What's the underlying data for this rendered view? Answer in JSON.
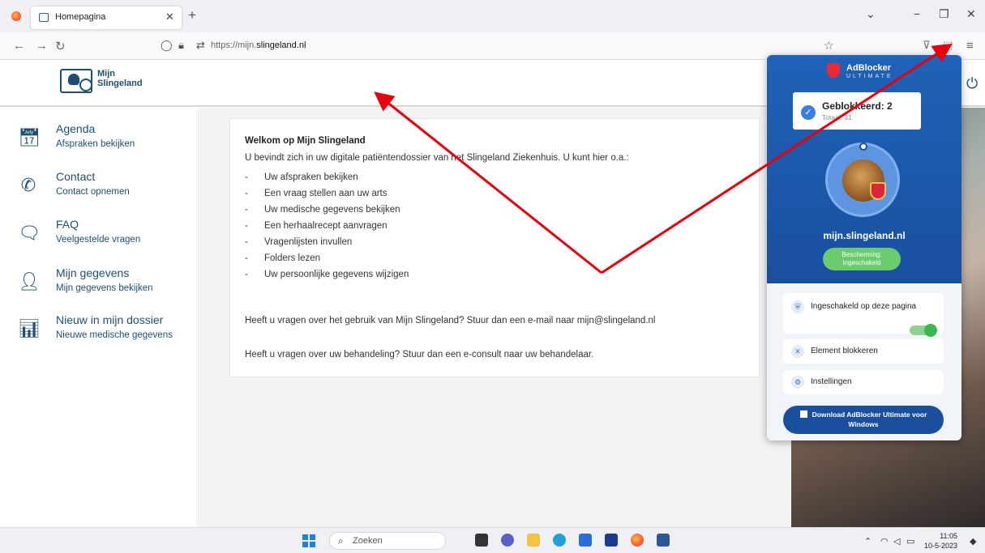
{
  "browser": {
    "tab_title": "Homepagina",
    "url_prefix": "https://mijn.",
    "url_domain": "slingeland.nl"
  },
  "site": {
    "logo_line1": "Mijn",
    "logo_line2": "Slingeland"
  },
  "sidebar": {
    "items": [
      {
        "title": "Agenda",
        "subtitle": "Afspraken bekijken",
        "icon": "calendar-icon"
      },
      {
        "title": "Contact",
        "subtitle": "Contact opnemen",
        "icon": "phone-icon"
      },
      {
        "title": "FAQ",
        "subtitle": "Veelgestelde vragen",
        "icon": "chat-icon"
      },
      {
        "title": "Mijn gegevens",
        "subtitle": "Mijn gegevens bekijken",
        "icon": "person-icon"
      },
      {
        "title": "Nieuw in mijn dossier",
        "subtitle": "Nieuwe medische gegevens",
        "icon": "chart-icon"
      }
    ]
  },
  "main": {
    "title": "Welkom op Mijn Slingeland",
    "intro": "U bevindt zich in uw digitale patiëntendossier van het Slingeland Ziekenhuis. U kunt hier o.a.:",
    "list": [
      "Uw afspraken bekijken",
      "Een vraag stellen aan uw arts",
      "Uw medische gegevens bekijken",
      "Een herhaalrecept aanvragen",
      "Vragenlijsten invullen",
      "Folders lezen",
      "Uw persoonlijke gegevens wijzigen"
    ],
    "dash": "-",
    "question1": "Heeft u vragen over het gebruik van Mijn Slingeland? Stuur dan een e-mail naar mijn@slingeland.nl",
    "question2": "Heeft u vragen over uw behandeling? Stuur dan een e-consult naar uw behandelaar."
  },
  "adblocker": {
    "brand": "AdBlocker",
    "brand_sub": "ULTIMATE",
    "blocked_label": "Geblokkeerd: 2",
    "total_label": "Totaal: 31",
    "domain": "mijn.slingeland.nl",
    "protection_line1": "Bescherming:",
    "protection_line2": "Ingeschakeld",
    "option_enabled": "Ingeschakeld op deze pagina",
    "option_block": "Element blokkeren",
    "option_settings": "Instellingen",
    "download_line1": "Download AdBlocker Ultimate voor",
    "download_line2": "Windows"
  },
  "taskbar": {
    "search_placeholder": "Zoeken",
    "time": "11:05",
    "date": "10-5-2023"
  },
  "colors": {
    "brand": "#1d4f73",
    "adblock_blue": "#1a4f9e",
    "arrow_red": "#e8000b"
  }
}
